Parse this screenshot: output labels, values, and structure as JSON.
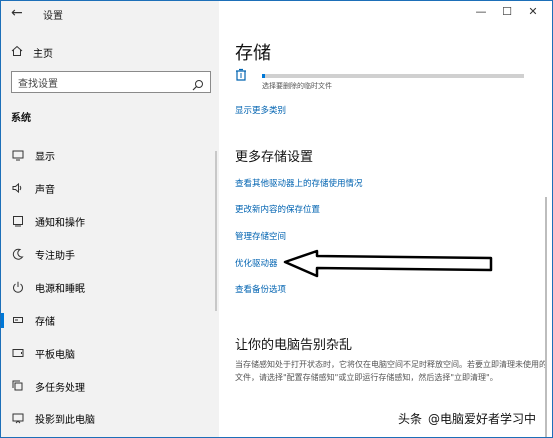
{
  "sidebar": {
    "back_label": "←",
    "app_title": "设置",
    "home_label": "主页",
    "search": {
      "value": "查找设置",
      "placeholder": "查找设置"
    },
    "section_label": "系统",
    "items": [
      {
        "label": "显示",
        "icon": "monitor-icon",
        "active": false
      },
      {
        "label": "声音",
        "icon": "speaker-icon",
        "active": false
      },
      {
        "label": "通知和操作",
        "icon": "notification-icon",
        "active": false
      },
      {
        "label": "专注助手",
        "icon": "moon-icon",
        "active": false
      },
      {
        "label": "电源和睡眠",
        "icon": "power-icon",
        "active": false
      },
      {
        "label": "存储",
        "icon": "storage-icon",
        "active": true
      },
      {
        "label": "平板电脑",
        "icon": "tablet-icon",
        "active": false
      },
      {
        "label": "多任务处理",
        "icon": "multitask-icon",
        "active": false
      },
      {
        "label": "投影到此电脑",
        "icon": "project-icon",
        "active": false
      }
    ]
  },
  "window_controls": {
    "minimize": "—",
    "maximize": "☐",
    "close": "✕"
  },
  "main": {
    "title": "存储",
    "temp_files": {
      "description": "选择要删除的临时文件",
      "usage_fraction": 0.01
    },
    "show_more_link": "显示更多类别",
    "more_settings_heading": "更多存储设置",
    "links": [
      "查看其他驱动器上的存储使用情况",
      "更改新内容的保存位置",
      "管理存储空间",
      "优化驱动器",
      "查看备份选项"
    ],
    "declutter_heading": "让你的电脑告别杂乱",
    "declutter_text": "当存储感知处于打开状态时，它将仅在电脑空间不足时释放空间。若要立即清理未使用的文件，请选择\"配置存储感知\"或立即运行存储感知，然后选择\"立即清理\"。"
  },
  "watermark": {
    "brand": "头条",
    "text": "@电脑爱好者学习中"
  },
  "colors": {
    "accent": "#0078d7",
    "link": "#0063b1",
    "sidebar_bg": "#f2f2f2"
  }
}
